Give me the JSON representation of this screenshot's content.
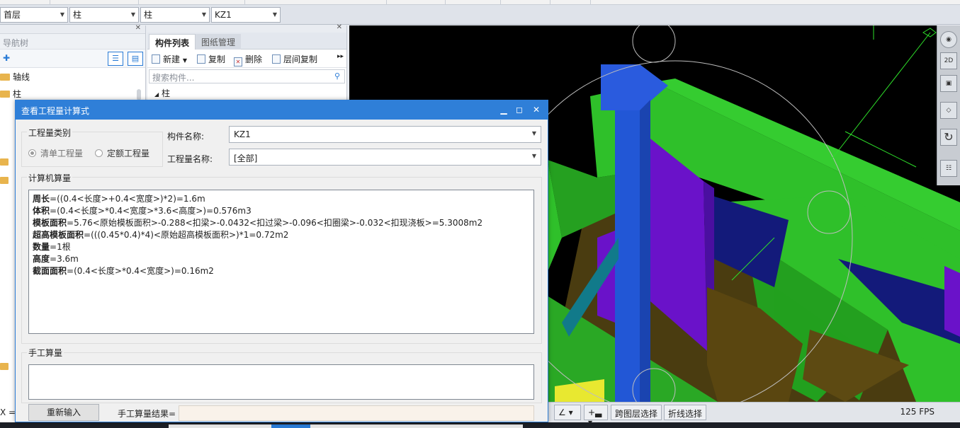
{
  "floor_selector": {
    "value": "首层"
  },
  "type_selector": {
    "value": "柱"
  },
  "subtype_selector": {
    "value": "柱"
  },
  "component_selector": {
    "value": "KZ1"
  },
  "nav": {
    "header": "导航树",
    "items": [
      {
        "label": "轴线",
        "icon": "folder-icon"
      },
      {
        "label": "柱",
        "icon": "folder-icon"
      }
    ]
  },
  "component_panel": {
    "tabs": [
      {
        "label": "构件列表",
        "active": true
      },
      {
        "label": "图纸管理",
        "active": false
      }
    ],
    "toolbar": {
      "new": "新建",
      "copy": "复制",
      "delete": "删除",
      "floor_copy": "层间复制"
    },
    "search_placeholder": "搜索构件...",
    "tree_root": "柱"
  },
  "dialog": {
    "title": "查看工程量计算式",
    "category_label": "工程量类别",
    "radio_list": "清单工程量",
    "radio_quota": "定额工程量",
    "component_name_label": "构件名称:",
    "component_name_value": "KZ1",
    "quantity_name_label": "工程量名称:",
    "quantity_name_value": "[全部]",
    "computer_label": "计算机算量",
    "formulas": [
      {
        "name": "周长",
        "expr": "=((0.4<长度>+0.4<宽度>)*2)=1.6m"
      },
      {
        "name": "体积",
        "expr": "=(0.4<长度>*0.4<宽度>*3.6<高度>)=0.576m3"
      },
      {
        "name": "模板面积",
        "expr": "=5.76<原始模板面积>-0.288<扣梁>-0.0432<扣过梁>-0.096<扣圈梁>-0.032<扣现浇板>=5.3008m2"
      },
      {
        "name": "超高模板面积",
        "expr": "=(((0.45*0.4)*4)<原始超高模板面积>)*1=0.72m2"
      },
      {
        "name": "数量",
        "expr": "=1根"
      },
      {
        "name": "高度",
        "expr": "=3.6m"
      },
      {
        "name": "截面面积",
        "expr": "=(0.4<长度>*0.4<宽度>)=0.16m2"
      }
    ],
    "manual_label": "手工算量",
    "reinput_button": "重新输入",
    "manual_result_label": "手工算量结果="
  },
  "status": {
    "cross_layer_select": "跨图层选择",
    "polyline_select": "折线选择",
    "fps": "125 FPS",
    "left_text": "X ="
  },
  "view_tools": {
    "view_2d": "2D"
  },
  "colors": {
    "title_blue": "#2f7fd8",
    "beam_green": "#2fc02a",
    "column_blue": "#2257d6",
    "wall_purple": "#6a12c9",
    "slab_brown": "#5d4a12",
    "window_navy": "#131a7a",
    "axis_green": "#2ee02a"
  }
}
